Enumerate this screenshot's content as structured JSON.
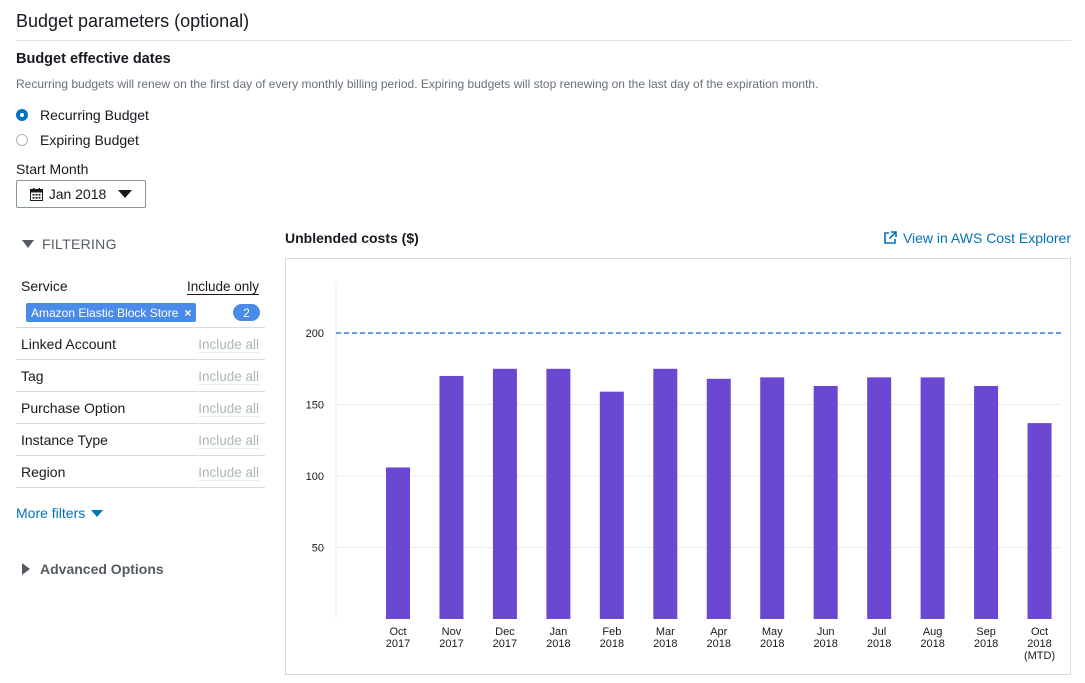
{
  "header": {
    "title": "Budget parameters (optional)"
  },
  "dates": {
    "heading": "Budget effective dates",
    "description": "Recurring budgets will renew on the first day of every monthly billing period. Expiring budgets will stop renewing on the last day of the expiration month.",
    "options": [
      {
        "label": "Recurring Budget",
        "selected": true
      },
      {
        "label": "Expiring Budget",
        "selected": false
      }
    ],
    "start_label": "Start Month",
    "start_value": "Jan 2018"
  },
  "filtering": {
    "heading": "FILTERING",
    "service": {
      "label": "Service",
      "mode": "Include only",
      "tag": "Amazon Elastic Block Store",
      "count": "2"
    },
    "rows": [
      {
        "label": "Linked Account",
        "value": "Include all"
      },
      {
        "label": "Tag",
        "value": "Include all"
      },
      {
        "label": "Purchase Option",
        "value": "Include all"
      },
      {
        "label": "Instance Type",
        "value": "Include all"
      },
      {
        "label": "Region",
        "value": "Include all"
      }
    ],
    "more_filters": "More filters",
    "advanced": "Advanced Options"
  },
  "chart": {
    "title": "Unblended costs ($)",
    "link": "View in AWS Cost Explorer"
  },
  "colors": {
    "bar": "#6a48d2",
    "budget_line": "#3c86e0",
    "link": "#0073bb",
    "tag": "#4a8ae8"
  },
  "chart_data": {
    "type": "bar",
    "title": "Unblended costs ($)",
    "categories": [
      [
        "Oct",
        "2017"
      ],
      [
        "Nov",
        "2017"
      ],
      [
        "Dec",
        "2017"
      ],
      [
        "Jan",
        "2018"
      ],
      [
        "Feb",
        "2018"
      ],
      [
        "Mar",
        "2018"
      ],
      [
        "Apr",
        "2018"
      ],
      [
        "May",
        "2018"
      ],
      [
        "Jun",
        "2018"
      ],
      [
        "Jul",
        "2018"
      ],
      [
        "Aug",
        "2018"
      ],
      [
        "Sep",
        "2018"
      ],
      [
        "Oct",
        "2018",
        "(MTD)"
      ]
    ],
    "values": [
      106,
      170,
      175,
      175,
      159,
      175,
      168,
      169,
      163,
      169,
      169,
      163,
      137
    ],
    "budget_line": 200,
    "yticks": [
      50,
      100,
      150,
      200
    ],
    "ylim": [
      0,
      235
    ],
    "grid": true
  }
}
